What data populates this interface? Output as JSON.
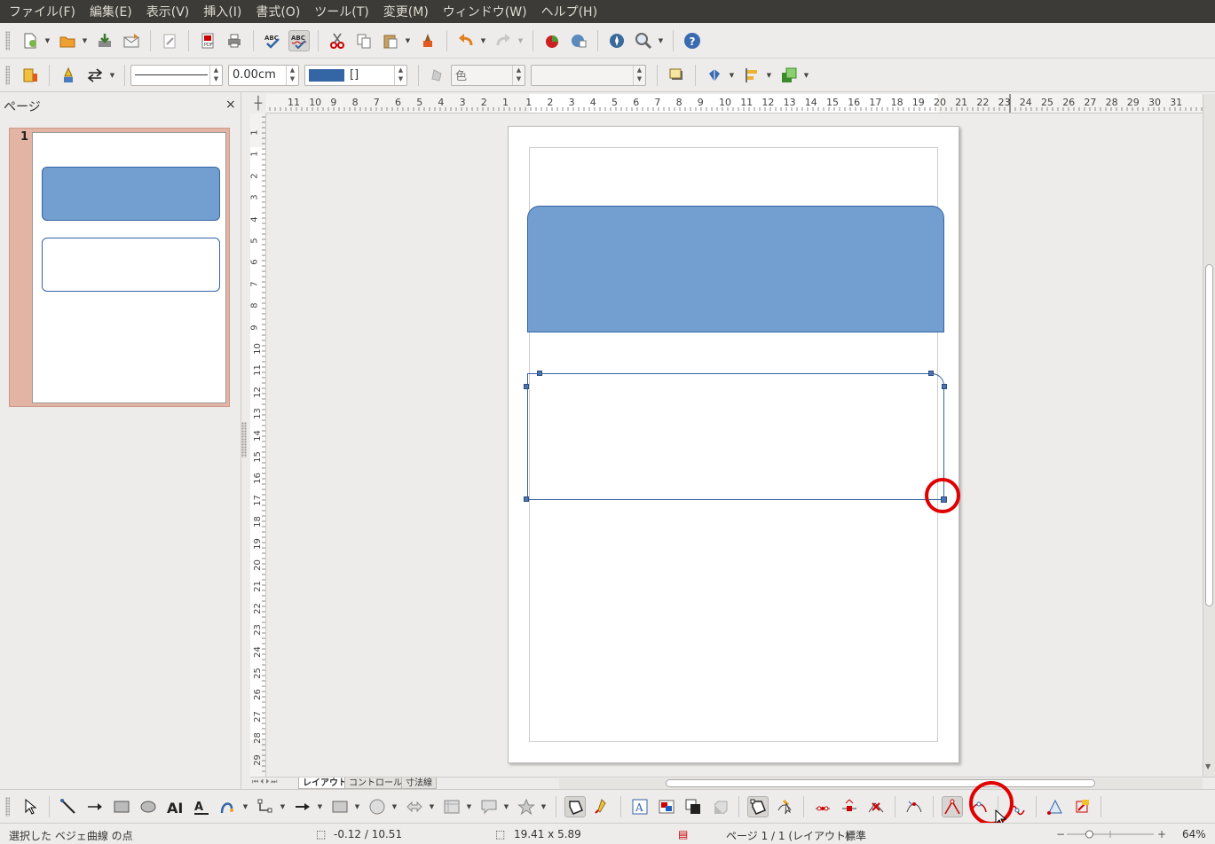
{
  "menu": [
    "ファイル(F)",
    "編集(E)",
    "表示(V)",
    "挿入(I)",
    "書式(O)",
    "ツール(T)",
    "変更(M)",
    "ウィンドウ(W)",
    "ヘルプ(H)"
  ],
  "line_toolbar": {
    "line_width": "0.00cm",
    "area_style": "色",
    "area_fill_value": "[]",
    "line_color": "#3465a4"
  },
  "pages_pane": {
    "title": "ページ",
    "close": "×",
    "thumbnails": [
      {
        "number": "1"
      }
    ]
  },
  "ruler": {
    "h_labels": [
      "11",
      "10",
      "9",
      "8",
      "7",
      "6",
      "5",
      "4",
      "3",
      "2",
      "1",
      "1",
      "2",
      "3",
      "4",
      "5",
      "6",
      "7",
      "8",
      "9",
      "10",
      "11",
      "12",
      "13",
      "14",
      "15",
      "16",
      "17",
      "18",
      "19",
      "20",
      "21",
      "22",
      "23",
      "24",
      "25",
      "26",
      "27",
      "28",
      "29",
      "30",
      "31"
    ],
    "v_labels": [
      "1",
      "1",
      "2",
      "3",
      "4",
      "5",
      "6",
      "7",
      "8",
      "9",
      "10",
      "11",
      "12",
      "13",
      "14",
      "15",
      "16",
      "17",
      "18",
      "19",
      "20",
      "21",
      "22",
      "23",
      "24",
      "25",
      "26",
      "27",
      "28",
      "29"
    ]
  },
  "layer_tabs": [
    {
      "label": "レイアウト",
      "active": true
    },
    {
      "label": "コントロール",
      "active": false
    },
    {
      "label": "寸法線",
      "active": false
    }
  ],
  "shapes": {
    "top_rect_color": "#729fcf",
    "border_color": "#3465a4"
  },
  "drawbar": {
    "icons": [
      "select-icon",
      "line-icon",
      "arrow-line-icon",
      "rectangle-icon",
      "ellipse-icon",
      "fontwork-text-icon",
      "vertical-text-icon",
      "curve-icon",
      "connector-icon",
      "lines-arrows-icon",
      "basic-shapes-icon",
      "symbol-shapes-icon",
      "block-arrows-icon",
      "flowchart-icon",
      "callouts-icon",
      "stars-icon",
      "points-icon",
      "glue-points-icon",
      "text-frame-icon",
      "gallery-icon",
      "arrange-icon",
      "extrusion-icon",
      "points-mode-icon",
      "move-points-icon",
      "insert-points-icon",
      "delete-points-icon",
      "split-curve-icon",
      "convert-curve-icon",
      "corner-point-icon",
      "smooth-transition-icon",
      "symmetric-transition-icon",
      "close-bezier-icon",
      "eliminate-points-icon"
    ]
  },
  "status": {
    "message": "選択した ベジェ曲線 の点",
    "position": "-0.12 / 10.51",
    "size": "19.41 x 5.89",
    "page": "ページ 1 / 1 (レイアウト)",
    "style": "標準",
    "zoom": "64%",
    "zoom_level_percent": 64
  }
}
